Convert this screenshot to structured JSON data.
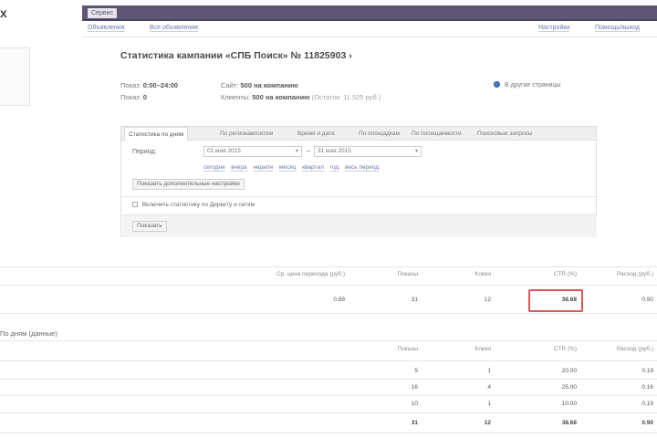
{
  "nav": {
    "logo_fragment": "x",
    "top_button": "Сервис",
    "sublinks": [
      "Объявления",
      "Все объявления"
    ],
    "sublinks_right": [
      "Настройки",
      "Помощь/выход"
    ]
  },
  "campaign": {
    "title": "Статистика кампании «СПБ Поиск» № 11825903 ›",
    "meta": {
      "r1c1_label": "Показ:",
      "r1c1_value": "0:00–24:00",
      "r1c2_label": "Сайт:",
      "r1c2_value": "500 на компанию",
      "r2c1_label": "Показ:",
      "r2c1_value": "0",
      "r2c2_label": "Клиенты:",
      "r2c2_value": "500 на компанию",
      "r2c2_extra": "(Остаток: 11 525 руб.)"
    },
    "radio_label": "В другие страницы"
  },
  "filters": {
    "tabs": [
      "Статистика по дням",
      "По регионам/сетям",
      "Время и дата",
      "По площадкам",
      "По посещаемости",
      "Поисковые запросы"
    ],
    "period_label": "Период:",
    "date_from": "01 мая 2015",
    "date_to": "31 мая 2015",
    "quick_ranges": [
      "сегодня",
      "вчера",
      "неделя",
      "месяц",
      "квартал",
      "год",
      "весь период"
    ],
    "apply_button": "Показать дополнительные настройки",
    "checkbox_label": "Включить статистику по Директу и сетям",
    "submit_button": "Показать"
  },
  "summary": {
    "headers": [
      "Ср. цена перехода (руб.)",
      "Показы",
      "Клики",
      "CTR (%)",
      "Расход (руб.)"
    ],
    "row": [
      "0.88",
      "31",
      "12",
      "38.68",
      "0.90"
    ]
  },
  "sections": {
    "daily_title": "По дням (данные)",
    "daily_headers": [
      "Показы",
      "Клики",
      "CTR (%)",
      "Расход (руб.)"
    ],
    "daily_rows": [
      [
        "5",
        "1",
        "20.00",
        "0.19"
      ],
      [
        "16",
        "4",
        "25.00",
        "0.16"
      ],
      [
        "10",
        "1",
        "10.00",
        "0.19"
      ],
      [
        "31",
        "12",
        "38.68",
        "0.90"
      ]
    ]
  }
}
